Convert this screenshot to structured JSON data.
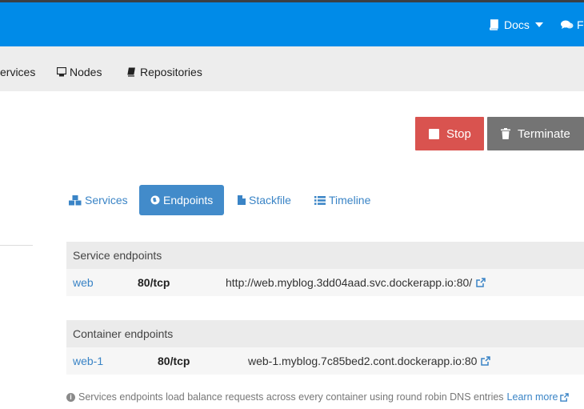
{
  "topbar": {
    "docs_label": "Docs",
    "forum_label": "F"
  },
  "subnav": {
    "items": [
      {
        "label": "ervices",
        "icon": "cubes-icon"
      },
      {
        "label": "Nodes",
        "icon": "server-icon"
      },
      {
        "label": "Repositories",
        "icon": "book-icon"
      }
    ]
  },
  "actions": {
    "stop_label": "Stop",
    "terminate_label": "Terminate"
  },
  "tabs": [
    {
      "label": "Services",
      "icon": "cubes-icon",
      "active": false
    },
    {
      "label": "Endpoints",
      "icon": "globe-icon",
      "active": true
    },
    {
      "label": "Stackfile",
      "icon": "file-icon",
      "active": false
    },
    {
      "label": "Timeline",
      "icon": "list-icon",
      "active": false
    }
  ],
  "service_endpoints": {
    "title": "Service endpoints",
    "rows": [
      {
        "name": "web",
        "port": "80/tcp",
        "url": "http://web.myblog.3dd04aad.svc.dockerapp.io:80/"
      }
    ]
  },
  "container_endpoints": {
    "title": "Container endpoints",
    "rows": [
      {
        "name": "web-1",
        "port": "80/tcp",
        "url": "web-1.myblog.7c85bed2.cont.dockerapp.io:80"
      }
    ]
  },
  "footer_note": {
    "text": "Services endpoints load balance requests across every container using round robin DNS entries",
    "link_label": "Learn more"
  },
  "colors": {
    "topbar": "#008be8",
    "stop": "#d9534f",
    "terminate": "#747474",
    "active_tab": "#428bca",
    "link": "#3a84c6"
  }
}
